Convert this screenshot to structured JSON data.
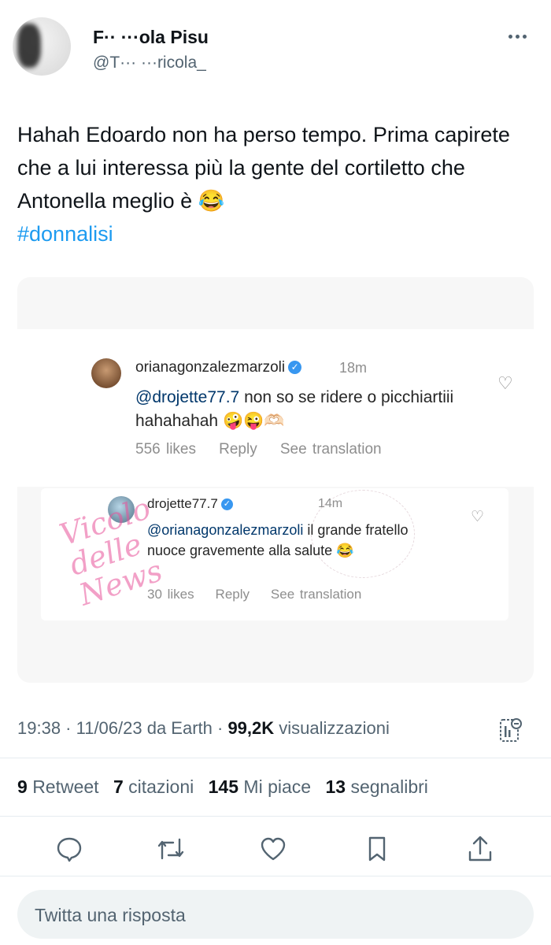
{
  "author": {
    "display_name": "F·· ···ola Pisu",
    "handle": "@T··· ···ricola_"
  },
  "tweet": {
    "text": "Hahah Edoardo non ha perso tempo. Prima capirete che a lui interessa più la gente del cortiletto che Antonella meglio è 😂",
    "hashtag": "#donnalisi"
  },
  "embed": {
    "comment1": {
      "username": "orianagonzalezmarzoli",
      "time": "18m",
      "mention": "@drojette77.7",
      "text": " non so se ridere o picchiartiii hahahahah 🤪😜🫶🏻",
      "likes": "556 likes",
      "reply": "Reply",
      "translate": "See translation"
    },
    "comment2": {
      "username": "drojette77.7",
      "time": "14m",
      "mention": "@orianagonzalezmarzoli",
      "text": " il grande fratello nuoce gravemente alla salute 😂",
      "likes": "30 likes",
      "reply": "Reply",
      "translate": "See translation"
    },
    "watermark": "Vicolo delle News"
  },
  "meta": {
    "time": "19:38 · 11/06/23 da Earth · ",
    "views_count": "99,2K",
    "views_label": " visualizzazioni"
  },
  "stats": [
    {
      "count": "9",
      "label": "Retweet"
    },
    {
      "count": "7",
      "label": "citazioni"
    },
    {
      "count": "145",
      "label": "Mi piace"
    },
    {
      "count": "13",
      "label": "segnalibri"
    }
  ],
  "icons": {
    "reply": "reply-icon",
    "retweet": "retweet-icon",
    "like": "heart-icon",
    "bookmark": "bookmark-icon",
    "share": "share-icon",
    "analytics": "analytics-icon",
    "more": "more-icon"
  },
  "reply_box": {
    "placeholder": "Twitta una risposta"
  },
  "colors": {
    "accent": "#1d9bf0",
    "text": "#0f1419",
    "secondary": "#536471"
  }
}
